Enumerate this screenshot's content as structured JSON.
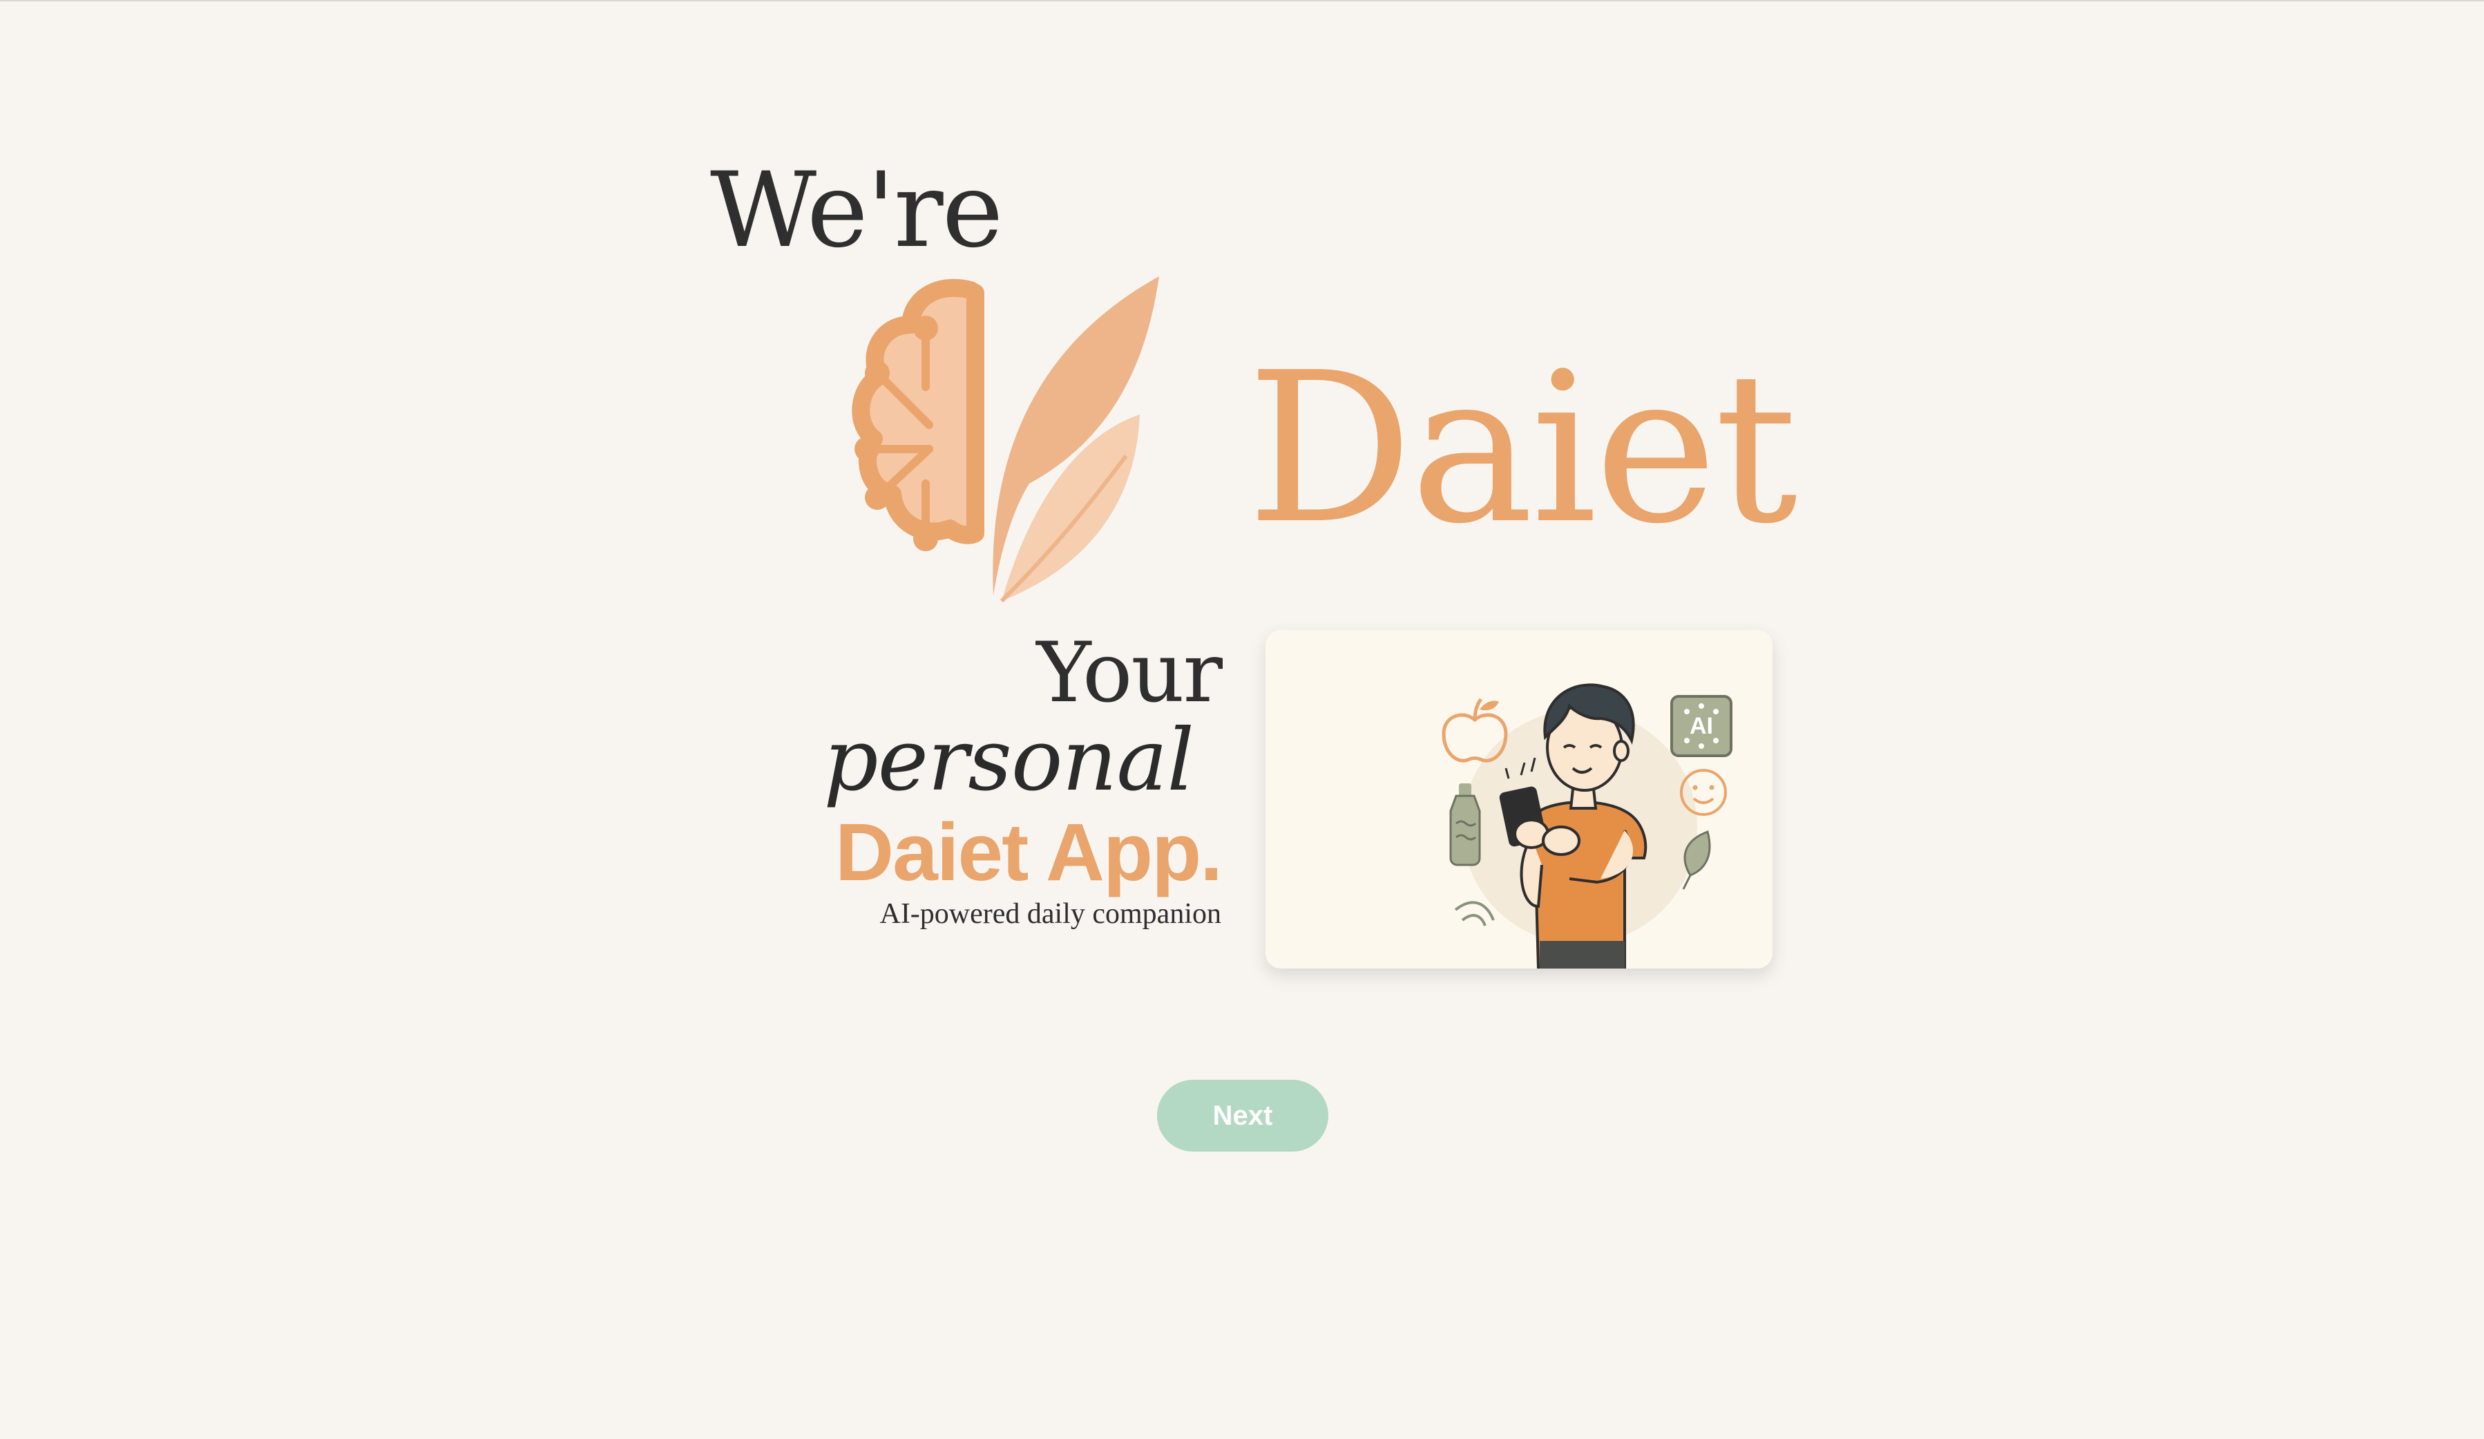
{
  "header": {
    "intro": "We're",
    "brand_name": "Daiet"
  },
  "tagline": {
    "line1": "Your",
    "line2": "personal",
    "line3": "Daiet App.",
    "subtitle": "AI-powered daily companion"
  },
  "illustration": {
    "badge_text": "AI",
    "icons": [
      "apple-icon",
      "water-bottle-icon",
      "ai-chip-icon",
      "smile-icon",
      "leaf-icon",
      "phone-icon"
    ]
  },
  "actions": {
    "next_label": "Next"
  },
  "colors": {
    "background": "#f8f5f1",
    "accent": "#e9a56c",
    "button": "#b3d8c3",
    "text": "#2f2f2f"
  }
}
